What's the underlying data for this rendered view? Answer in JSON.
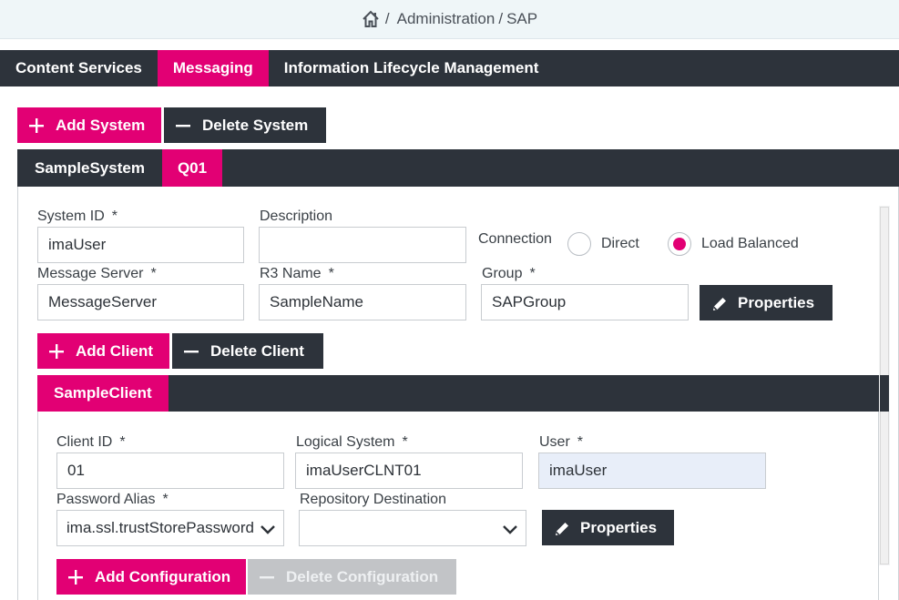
{
  "breadcrumb": {
    "items": [
      "Administration",
      "SAP"
    ],
    "separator": "/"
  },
  "main_tabs": [
    {
      "label": "Content Services",
      "active": false
    },
    {
      "label": "Messaging",
      "active": true
    },
    {
      "label": "Information Lifecycle Management",
      "active": false
    }
  ],
  "system_actions": {
    "add": "Add System",
    "delete": "Delete System"
  },
  "system_tabs": [
    {
      "label": "SampleSystem",
      "active": false
    },
    {
      "label": "Q01",
      "active": true
    }
  ],
  "system_form": {
    "system_id": {
      "label": "System ID",
      "required": "*",
      "value": "imaUser"
    },
    "description": {
      "label": "Description",
      "value": ""
    },
    "connection": {
      "label": "Connection",
      "options": [
        "Direct",
        "Load Balanced"
      ],
      "selected": "Load Balanced"
    },
    "message_server": {
      "label": "Message Server",
      "required": "*",
      "value": "MessageServer"
    },
    "r3_name": {
      "label": "R3 Name",
      "required": "*",
      "value": "SampleName"
    },
    "group": {
      "label": "Group",
      "required": "*",
      "value": "SAPGroup"
    },
    "properties_button": "Properties"
  },
  "client_actions": {
    "add": "Add Client",
    "delete": "Delete Client"
  },
  "client_tabs": [
    {
      "label": "SampleClient",
      "active": true
    }
  ],
  "client_form": {
    "client_id": {
      "label": "Client ID",
      "required": "*",
      "value": "01"
    },
    "logical_system": {
      "label": "Logical System",
      "required": "*",
      "value": "imaUserCLNT01"
    },
    "user": {
      "label": "User",
      "required": "*",
      "value": "imaUser"
    },
    "password_alias": {
      "label": "Password Alias",
      "required": "*",
      "value": "ima.ssl.trustStorePassword"
    },
    "repository_destination": {
      "label": "Repository Destination",
      "value": ""
    },
    "properties_button": "Properties"
  },
  "configuration_actions": {
    "add": "Add Configuration",
    "delete": "Delete Configuration",
    "delete_enabled": false
  },
  "colors": {
    "accent": "#e20074",
    "dark": "#2d333b",
    "breadcrumb_bg": "#eff6f8",
    "disabled": "#c2c4c7"
  }
}
